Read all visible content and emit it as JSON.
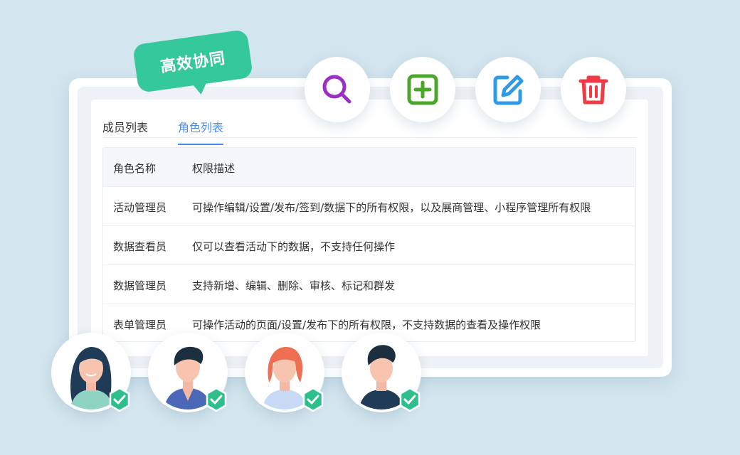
{
  "bubble": {
    "text": "高效协同"
  },
  "tabs": [
    {
      "label": "成员列表",
      "active": false
    },
    {
      "label": "角色列表",
      "active": true
    }
  ],
  "table": {
    "headers": [
      "角色名称",
      "权限描述"
    ],
    "rows": [
      [
        "活动管理员",
        "可操作编辑/设置/发布/签到/数据下的所有权限，以及展商管理、小程序管理所有权限"
      ],
      [
        "数据查看员",
        "仅可以查看活动下的数据，不支持任何操作"
      ],
      [
        "数据管理员",
        "支持新增、编辑、删除、审核、标记和群发"
      ],
      [
        "表单管理员",
        "可操作活动的页面/设置/发布下的所有权限，不支持数据的查看及操作权限"
      ]
    ]
  },
  "actions": [
    {
      "name": "search",
      "icon": "search-icon",
      "color": "#9b2ec4"
    },
    {
      "name": "add",
      "icon": "plus-square-icon",
      "color": "#4aa72a"
    },
    {
      "name": "edit",
      "icon": "edit-icon",
      "color": "#2f9be8"
    },
    {
      "name": "delete",
      "icon": "trash-icon",
      "color": "#ee3b46"
    }
  ],
  "colors": {
    "accent": "#4d8cf0",
    "bubble": "#35c89a",
    "check": "#2fbf8c",
    "background": "#d3e5ee"
  }
}
